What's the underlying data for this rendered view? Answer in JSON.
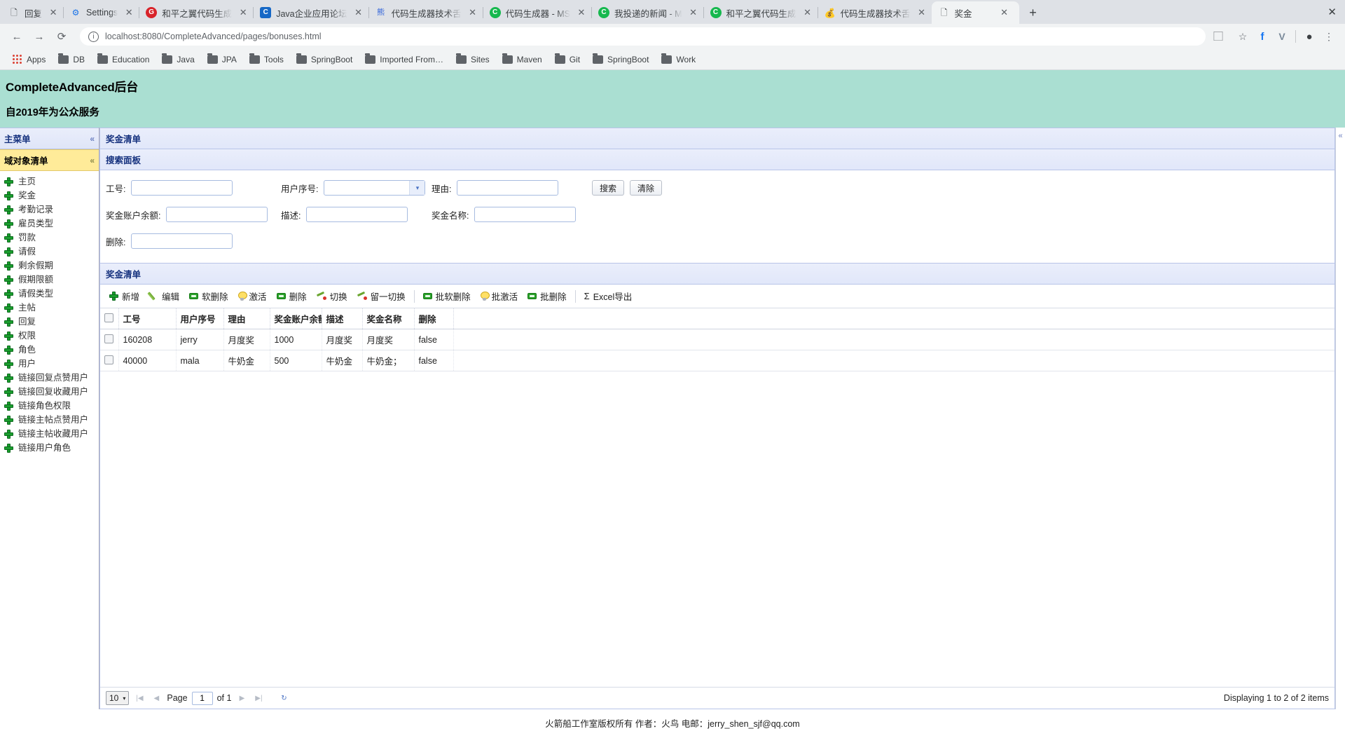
{
  "browser": {
    "tabs": [
      {
        "title": "回复",
        "favicon": "page-icon",
        "glyph": "🗋",
        "active": false
      },
      {
        "title": "Settings",
        "favicon": "gear-icon",
        "glyph": "⚙",
        "active": false
      },
      {
        "title": "和平之翼代码生成",
        "favicon": "g-logo-icon",
        "glyph": "G",
        "active": false
      },
      {
        "title": "Java企业应用论坛",
        "favicon": "c-logo-icon",
        "glyph": "C",
        "active": false
      },
      {
        "title": "代码生成器技术舌",
        "favicon": "baidu-icon",
        "glyph": "熊",
        "active": false
      },
      {
        "title": "代码生成器 - MS",
        "favicon": "c-green-icon",
        "glyph": "C",
        "active": false
      },
      {
        "title": "我投递的新闻 - M",
        "favicon": "c-green-icon",
        "glyph": "C",
        "active": false
      },
      {
        "title": "和平之翼代码生成",
        "favicon": "c-green-icon",
        "glyph": "C",
        "active": false
      },
      {
        "title": "代码生成器技术舌",
        "favicon": "moneybag-icon",
        "glyph": "💰",
        "active": false
      },
      {
        "title": "奖金",
        "favicon": "page-icon",
        "glyph": "🗋",
        "active": true
      }
    ],
    "new_tab_label": "+",
    "window_close_label": "✕",
    "nav": {
      "back": "←",
      "forward": "→",
      "reload": "⟳"
    },
    "omnibox": {
      "info": "i",
      "host": "localhost:8080",
      "path": "/CompleteAdvanced/pages/bonuses.html"
    },
    "toolbar_icons": [
      {
        "name": "translate-icon",
        "glyph": "⃞"
      },
      {
        "name": "bookmark-star-icon",
        "glyph": "☆"
      },
      {
        "name": "facebook-icon",
        "glyph": "f"
      },
      {
        "name": "v-extension-icon",
        "glyph": "V"
      },
      {
        "name": "profile-avatar-icon",
        "glyph": "●"
      },
      {
        "name": "chrome-menu-icon",
        "glyph": "⋮"
      }
    ],
    "bookmarks": [
      {
        "label": "Apps",
        "icon": "apps-grid-icon"
      },
      {
        "label": "DB",
        "icon": "folder-icon"
      },
      {
        "label": "Education",
        "icon": "folder-icon"
      },
      {
        "label": "Java",
        "icon": "folder-icon"
      },
      {
        "label": "JPA",
        "icon": "folder-icon"
      },
      {
        "label": "Tools",
        "icon": "folder-icon"
      },
      {
        "label": "SpringBoot",
        "icon": "folder-icon"
      },
      {
        "label": "Imported From…",
        "icon": "folder-icon"
      },
      {
        "label": "Sites",
        "icon": "folder-icon"
      },
      {
        "label": "Maven",
        "icon": "folder-icon"
      },
      {
        "label": "Git",
        "icon": "folder-icon"
      },
      {
        "label": "SpringBoot",
        "icon": "folder-icon"
      },
      {
        "label": "Work",
        "icon": "folder-icon"
      }
    ]
  },
  "app": {
    "title": "CompleteAdvanced后台",
    "subtitle": "自2019年为公众服务",
    "header_bg": "#aadfd2"
  },
  "sidebar": {
    "main_menu_title": "主菜单",
    "main_menu_chevron": "«",
    "accordion_title": "域对象清单",
    "accordion_chevron": "«",
    "items": [
      {
        "label": "主页"
      },
      {
        "label": "奖金"
      },
      {
        "label": "考勤记录"
      },
      {
        "label": "雇员类型"
      },
      {
        "label": "罚款"
      },
      {
        "label": "请假"
      },
      {
        "label": "剩余假期"
      },
      {
        "label": "假期限额"
      },
      {
        "label": "请假类型"
      },
      {
        "label": "主帖"
      },
      {
        "label": "回复"
      },
      {
        "label": "权限"
      },
      {
        "label": "角色"
      },
      {
        "label": "用户"
      },
      {
        "label": "链接回复点赞用户"
      },
      {
        "label": "链接回复收藏用户"
      },
      {
        "label": "链接角色权限"
      },
      {
        "label": "链接主帖点赞用户"
      },
      {
        "label": "链接主帖收藏用户"
      },
      {
        "label": "链接用户角色"
      }
    ]
  },
  "main": {
    "region_title": "奖金清单",
    "region_chevron": "«",
    "search": {
      "panel_title": "搜索面板",
      "fields": [
        {
          "label": "工号:",
          "type": "text",
          "value": ""
        },
        {
          "label": "用户序号:",
          "type": "select",
          "value": ""
        },
        {
          "label": "理由:",
          "type": "text",
          "value": ""
        },
        {
          "label": "奖金账户余额:",
          "type": "text",
          "value": ""
        },
        {
          "label": "描述:",
          "type": "text",
          "value": ""
        },
        {
          "label": "奖金名称:",
          "type": "text",
          "value": ""
        },
        {
          "label": "删除:",
          "type": "text",
          "value": ""
        }
      ],
      "search_button": "搜索",
      "clear_button": "清除"
    },
    "grid": {
      "title": "奖金清单",
      "toolbar": [
        {
          "label": "新增",
          "icon": "plus-icon"
        },
        {
          "label": "编辑",
          "icon": "pencil-icon"
        },
        {
          "label": "软删除",
          "icon": "green-bar-icon"
        },
        {
          "label": "激活",
          "icon": "bulb-icon"
        },
        {
          "label": "删除",
          "icon": "green-bar-icon"
        },
        {
          "label": "切换",
          "icon": "switch-icon"
        },
        {
          "label": "留一切换",
          "icon": "switch-icon"
        },
        {
          "label": "批软删除",
          "icon": "green-bar-icon"
        },
        {
          "label": "批激活",
          "icon": "bulb-icon"
        },
        {
          "label": "批删除",
          "icon": "green-bar-icon"
        },
        {
          "label": "Excel导出",
          "icon": "sigma-icon"
        }
      ],
      "columns": [
        "工号",
        "用户序号",
        "理由",
        "奖金账户余额",
        "描述",
        "奖金名称",
        "删除"
      ],
      "rows": [
        {
          "cells": [
            "160208",
            "jerry",
            "月度奖",
            "1000",
            "月度奖",
            "月度奖",
            "false"
          ]
        },
        {
          "cells": [
            "40000",
            "mala",
            "牛奶金",
            "500",
            "牛奶金",
            "牛奶金；",
            "false"
          ]
        }
      ]
    },
    "pager": {
      "page_size": "10",
      "page_size_caret": "▾",
      "first": "|◀",
      "prev": "◀",
      "page_label": "Page",
      "page_value": "1",
      "of_label": "of 1",
      "next": "▶",
      "last": "▶|",
      "refresh": "↻",
      "status": "Displaying 1 to 2 of 2 items"
    }
  },
  "footer": {
    "text": "火箭船工作室版权所有 作者：火鸟 电邮：jerry_shen_sjf@qq.com"
  }
}
